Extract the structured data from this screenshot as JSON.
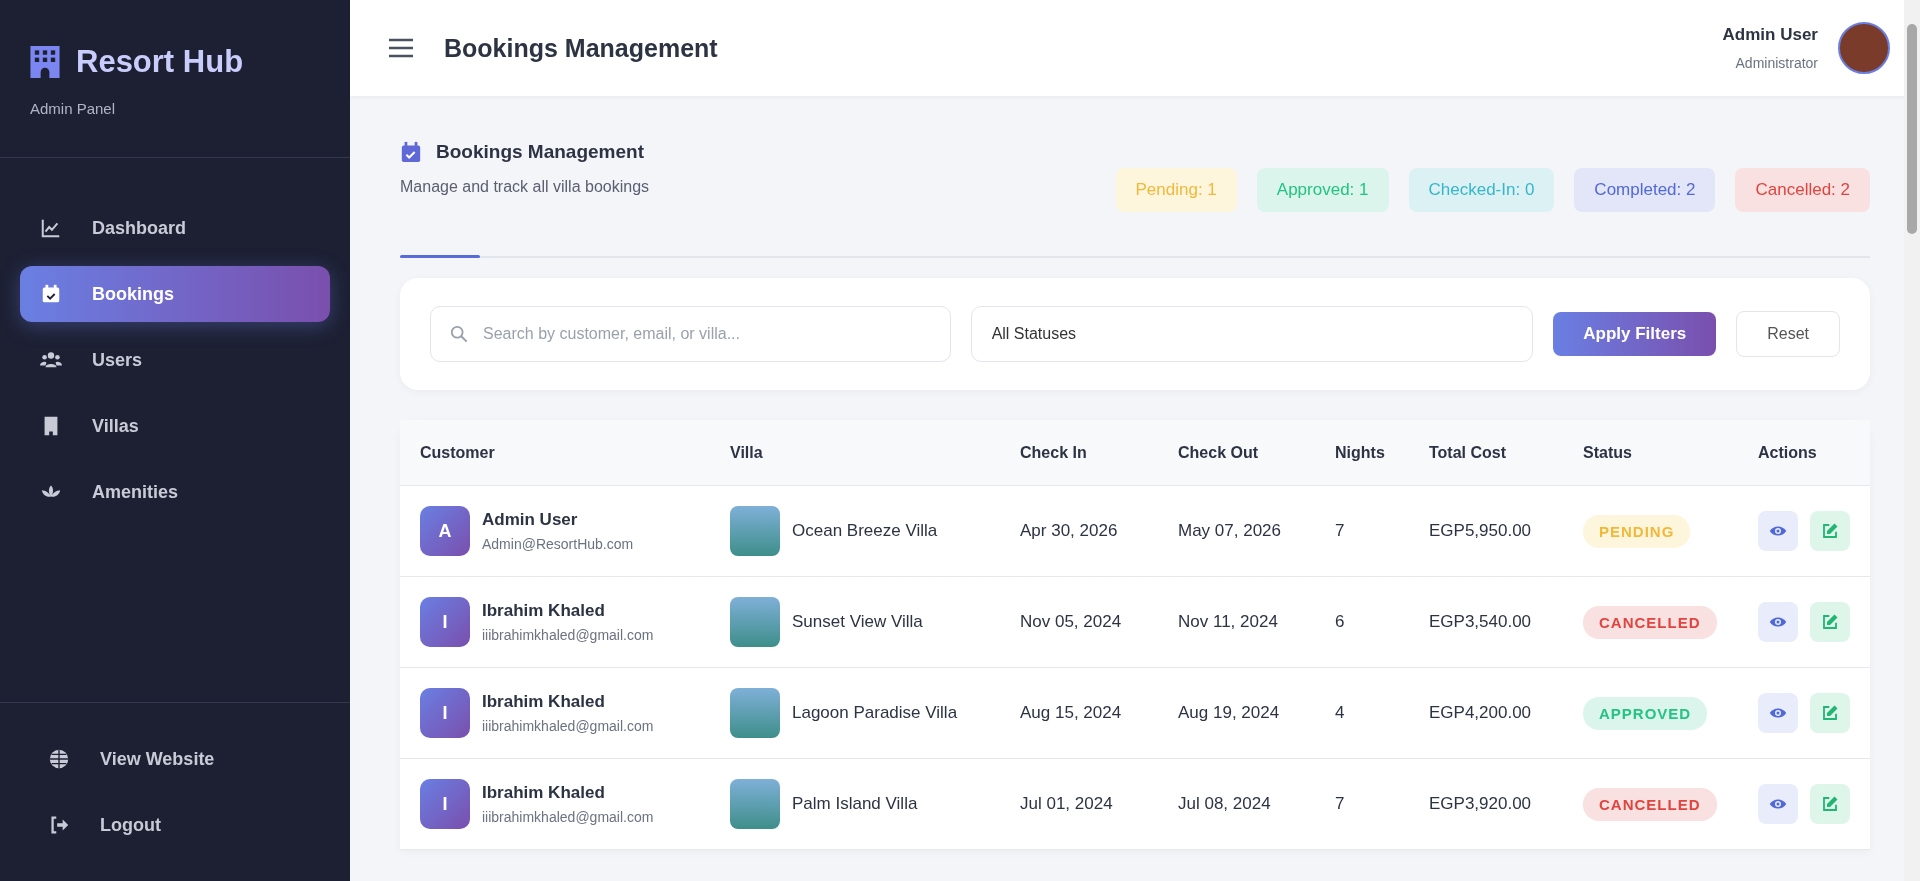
{
  "sidebar": {
    "brand": "Resort Hub",
    "subtitle": "Admin Panel",
    "items": [
      {
        "label": "Dashboard",
        "kind": "chart",
        "selected": false
      },
      {
        "label": "Bookings",
        "kind": "calendar",
        "selected": true
      },
      {
        "label": "Users",
        "kind": "users",
        "selected": false
      },
      {
        "label": "Villas",
        "kind": "building",
        "selected": false
      },
      {
        "label": "Amenities",
        "kind": "lotus",
        "selected": false
      }
    ],
    "footer_items": [
      {
        "label": "View Website",
        "kind": "globe"
      },
      {
        "label": "Logout",
        "kind": "logout"
      }
    ]
  },
  "header": {
    "title": "Bookings Management",
    "user_name": "Admin User",
    "user_role": "Administrator"
  },
  "section": {
    "title": "Bookings Management",
    "subtitle": "Manage and track all villa bookings",
    "counts": [
      {
        "label": "Pending: 1",
        "kind": "pending"
      },
      {
        "label": "Approved: 1",
        "kind": "approved"
      },
      {
        "label": "Checked-In: 0",
        "kind": "checkedin"
      },
      {
        "label": "Completed: 2",
        "kind": "completed"
      },
      {
        "label": "Cancelled: 2",
        "kind": "cancelled"
      }
    ]
  },
  "filters": {
    "search": {
      "placeholder": "Search by customer, email, or villa..."
    },
    "status_select": "All Statuses",
    "apply": "Apply Filters",
    "reset": "Reset"
  },
  "table": {
    "columns": [
      "Customer",
      "Villa",
      "Check In",
      "Check Out",
      "Nights",
      "Total Cost",
      "Status",
      "Actions"
    ],
    "rows": [
      {
        "initial": "A",
        "name": "Admin User",
        "email": "Admin@ResortHub.com",
        "villa": "Ocean Breeze Villa",
        "check_in": "Apr 30, 2026",
        "check_out": "May 07, 2026",
        "nights": "7",
        "total": "EGP5,950.00",
        "status": "PENDING",
        "kind": "pending"
      },
      {
        "initial": "I",
        "name": "Ibrahim Khaled",
        "email": "iiibrahimkhaled@gmail.com",
        "villa": "Sunset View Villa",
        "check_in": "Nov 05, 2024",
        "check_out": "Nov 11, 2024",
        "nights": "6",
        "total": "EGP3,540.00",
        "status": "CANCELLED",
        "kind": "cancelled"
      },
      {
        "initial": "I",
        "name": "Ibrahim Khaled",
        "email": "iiibrahimkhaled@gmail.com",
        "villa": "Lagoon Paradise Villa",
        "check_in": "Aug 15, 2024",
        "check_out": "Aug 19, 2024",
        "nights": "4",
        "total": "EGP4,200.00",
        "status": "APPROVED",
        "kind": "approved"
      },
      {
        "initial": "I",
        "name": "Ibrahim Khaled",
        "email": "iiibrahimkhaled@gmail.com",
        "villa": "Palm Island Villa",
        "check_in": "Jul 01, 2024",
        "check_out": "Jul 08, 2024",
        "nights": "7",
        "total": "EGP3,920.00",
        "status": "CANCELLED",
        "kind": "cancelled"
      }
    ]
  }
}
